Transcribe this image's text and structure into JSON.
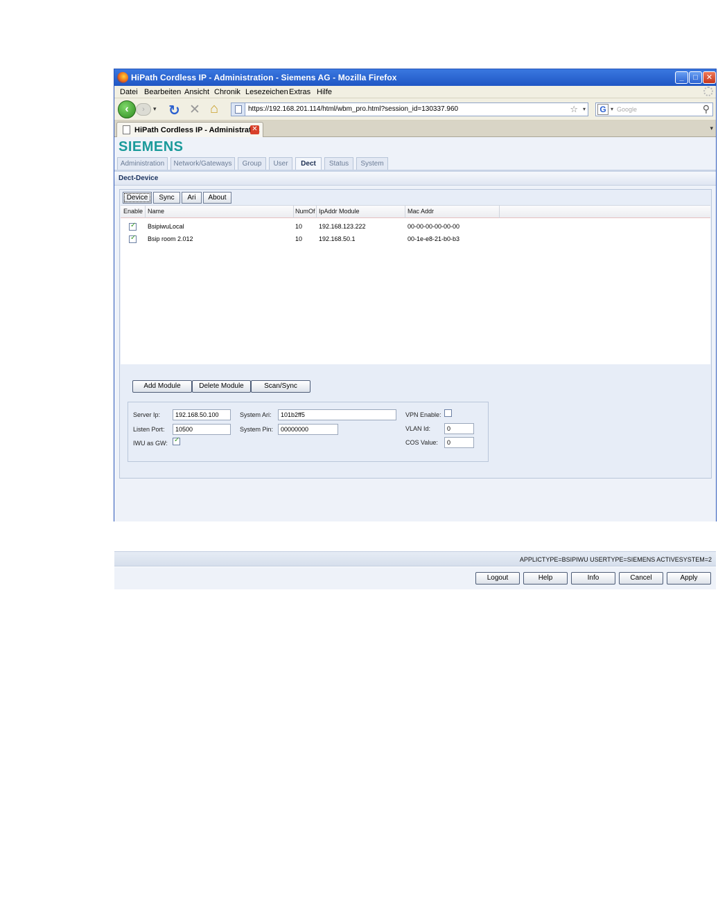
{
  "window": {
    "title": "HiPath Cordless IP - Administration - Siemens AG - Mozilla Firefox"
  },
  "menu": [
    "Datei",
    "Bearbeiten",
    "Ansicht",
    "Chronik",
    "Lesezeichen",
    "Extras",
    "Hilfe"
  ],
  "nav": {
    "url": "https://192.168.201.114/html/wbm_pro.html?session_id=130337.960",
    "search_placeholder": "Google"
  },
  "browser_tab": {
    "title": "HiPath Cordless IP - Administrati..."
  },
  "app": {
    "logo": "SIEMENS",
    "tabs": [
      "Administration",
      "Network/Gateways",
      "Group",
      "User",
      "Dect",
      "Status",
      "System"
    ],
    "active_tab": "Dect",
    "section_title": "Dect-Device",
    "subtabs": [
      "Device",
      "Sync",
      "Ari",
      "About"
    ],
    "active_subtab": "Device"
  },
  "table": {
    "columns": [
      "Enable",
      "Name",
      "NumOf",
      "IpAddr Module",
      "Mac Addr"
    ],
    "rows": [
      {
        "enabled": true,
        "name": "BsipiwuLocal",
        "numof": "10",
        "ip": "192.168.123.222",
        "mac": "00-00-00-00-00-00"
      },
      {
        "enabled": true,
        "name": "Bsip room 2.012",
        "numof": "10",
        "ip": "192.168.50.1",
        "mac": "00-1e-e8-21-b0-b3"
      }
    ]
  },
  "actions": {
    "add": "Add Module",
    "delete": "Delete Module",
    "scan": "Scan/Sync"
  },
  "form": {
    "server_ip_label": "Server Ip:",
    "server_ip": "192.168.50.100",
    "listen_port_label": "Listen Port:",
    "listen_port": "10500",
    "iwu_gw_label": "IWU as GW:",
    "iwu_gw": true,
    "system_ari_label": "System Ari:",
    "system_ari": "101b2ff5",
    "system_pin_label": "System Pin:",
    "system_pin": "00000000",
    "vpn_enable_label": "VPN Enable:",
    "vpn_enable": false,
    "vlan_id_label": "VLAN Id:",
    "vlan_id": "0",
    "cos_value_label": "COS Value:",
    "cos_value": "0"
  },
  "status_text": "APPLICTYPE=BSIPIWU USERTYPE=SIEMENS ACTIVESYSTEM=2",
  "footer_buttons": {
    "logout": "Logout",
    "help": "Help",
    "info": "Info",
    "cancel": "Cancel",
    "apply": "Apply"
  }
}
